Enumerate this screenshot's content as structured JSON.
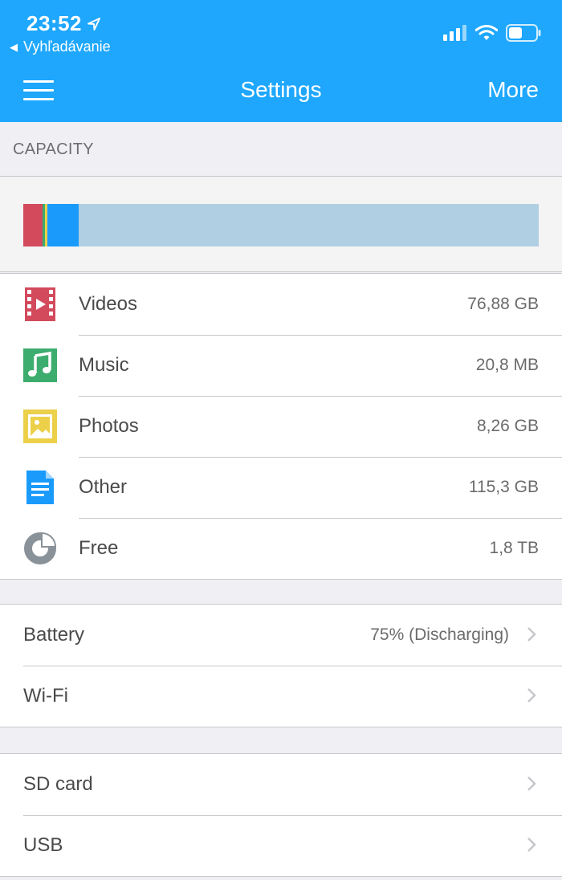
{
  "status_bar": {
    "time": "23:52",
    "back_app": "Vyhľadávanie",
    "location_icon": "location-arrow-icon",
    "signal_icon": "signal-icon",
    "wifi_icon": "wifi-icon",
    "battery_icon": "battery-icon",
    "battery_level": 0.5
  },
  "nav": {
    "title": "Settings",
    "more_label": "More",
    "menu_icon": "hamburger-menu-icon"
  },
  "capacity": {
    "header": "CAPACITY",
    "bar_colors": {
      "videos": "#d24a5c",
      "music": "#3cad6e",
      "photos": "#ecd04a",
      "other": "#1a9bfc",
      "free": "#b1cfe2"
    },
    "segments": [
      {
        "name": "Videos",
        "color": "#d24a5c",
        "percent": 3.8
      },
      {
        "name": "Music",
        "color": "#3cad6e",
        "percent": 0.45
      },
      {
        "name": "Photos",
        "color": "#ecd04a",
        "percent": 0.45
      },
      {
        "name": "Other",
        "color": "#1a9bfc",
        "percent": 6
      },
      {
        "name": "Free",
        "color": "#b1cfe2",
        "percent": 89.3
      }
    ]
  },
  "storage": [
    {
      "label": "Videos",
      "value": "76,88 GB",
      "icon": "video-film-icon",
      "color": "#d24a5c"
    },
    {
      "label": "Music",
      "value": "20,8 MB",
      "icon": "music-note-icon",
      "color": "#3cad6e"
    },
    {
      "label": "Photos",
      "value": "8,26 GB",
      "icon": "photo-icon",
      "color": "#ecd04a"
    },
    {
      "label": "Other",
      "value": "115,3 GB",
      "icon": "document-icon",
      "color": "#1a9bfc"
    },
    {
      "label": "Free",
      "value": "1,8 TB",
      "icon": "pie-chart-icon",
      "color": "#8a9299"
    }
  ],
  "settings_group1": [
    {
      "label": "Battery",
      "value": "75% (Discharging)"
    },
    {
      "label": "Wi-Fi",
      "value": ""
    }
  ],
  "settings_group2": [
    {
      "label": "SD card",
      "value": ""
    },
    {
      "label": "USB",
      "value": ""
    }
  ],
  "colors": {
    "accent": "#1ea7fd",
    "background": "#efeff4"
  }
}
